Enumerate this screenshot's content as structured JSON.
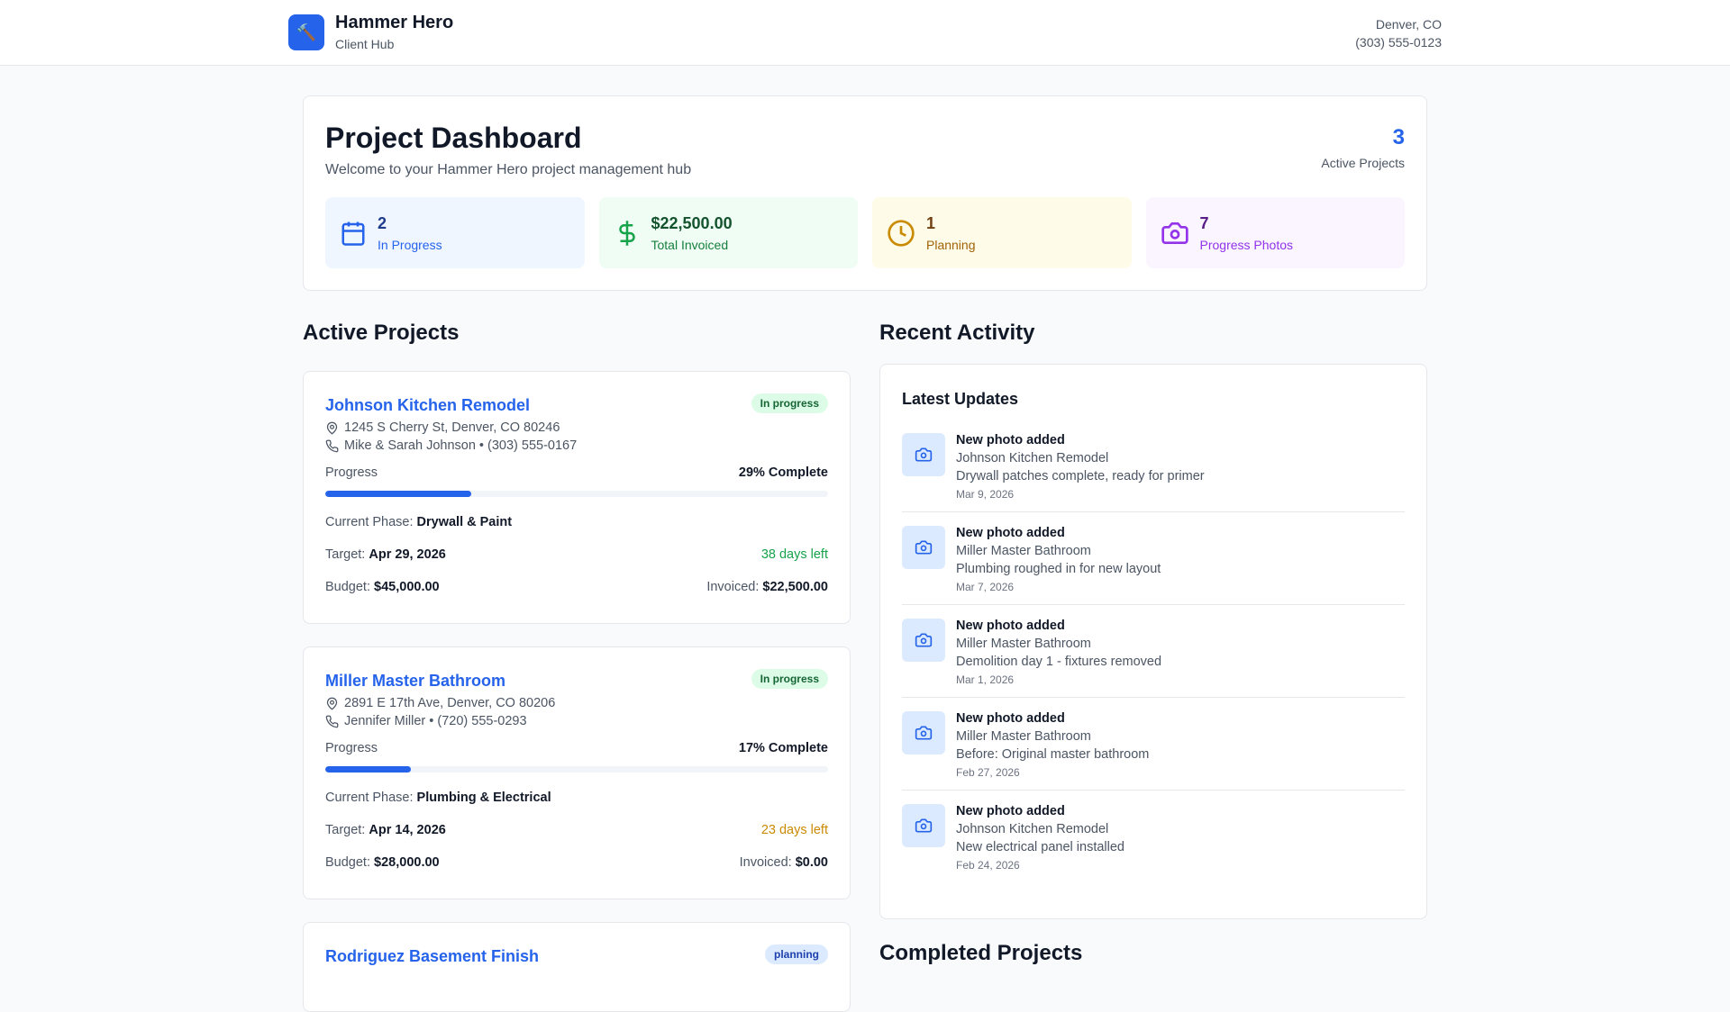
{
  "header": {
    "app_name": "Hammer Hero",
    "subtitle": "Client Hub",
    "location": "Denver, CO",
    "phone": "(303) 555-0123"
  },
  "dashboard": {
    "title": "Project Dashboard",
    "welcome": "Welcome to your Hammer Hero project management hub",
    "active_count": "3",
    "active_label": "Active Projects",
    "stats": [
      {
        "value": "2",
        "label": "In Progress",
        "icon": "calendar-icon",
        "color": "#2563eb"
      },
      {
        "value": "$22,500.00",
        "label": "Total Invoiced",
        "icon": "dollar-icon",
        "color": "#16a34a"
      },
      {
        "value": "1",
        "label": "Planning",
        "icon": "clock-icon",
        "color": "#ca8a04"
      },
      {
        "value": "7",
        "label": "Progress Photos",
        "icon": "camera-icon",
        "color": "#9333ea"
      }
    ]
  },
  "active_heading": "Active Projects",
  "projects": [
    {
      "name": "Johnson Kitchen Remodel",
      "status": "In progress",
      "address": "1245 S Cherry St, Denver, CO 80246",
      "contact": "Mike & Sarah Johnson • (303) 555-0167",
      "progress_label": "Progress",
      "progress_text": "29% Complete",
      "progress": 29,
      "phase_label": "Current Phase:",
      "phase": "Drywall & Paint",
      "target_label": "Target:",
      "target": "Apr 29, 2026",
      "days_left": "38 days left",
      "budget_label": "Budget:",
      "budget": "$45,000.00",
      "invoiced_label": "Invoiced:",
      "invoiced": "$22,500.00"
    },
    {
      "name": "Miller Master Bathroom",
      "status": "In progress",
      "address": "2891 E 17th Ave, Denver, CO 80206",
      "contact": "Jennifer Miller • (720) 555-0293",
      "progress_label": "Progress",
      "progress_text": "17% Complete",
      "progress": 17,
      "phase_label": "Current Phase:",
      "phase": "Plumbing & Electrical",
      "target_label": "Target:",
      "target": "Apr 14, 2026",
      "days_left": "23 days left",
      "budget_label": "Budget:",
      "budget": "$28,000.00",
      "invoiced_label": "Invoiced:",
      "invoiced": "$0.00"
    },
    {
      "name": "Rodriguez Basement Finish",
      "status": "planning"
    }
  ],
  "recent_heading": "Recent Activity",
  "activity": {
    "title": "Latest Updates",
    "items": [
      {
        "title": "New photo added",
        "project": "Johnson Kitchen Remodel",
        "desc": "Drywall patches complete, ready for primer",
        "date": "Mar 9, 2026"
      },
      {
        "title": "New photo added",
        "project": "Miller Master Bathroom",
        "desc": "Plumbing roughed in for new layout",
        "date": "Mar 7, 2026"
      },
      {
        "title": "New photo added",
        "project": "Miller Master Bathroom",
        "desc": "Demolition day 1 - fixtures removed",
        "date": "Mar 1, 2026"
      },
      {
        "title": "New photo added",
        "project": "Miller Master Bathroom",
        "desc": "Before: Original master bathroom",
        "date": "Feb 27, 2026"
      },
      {
        "title": "New photo added",
        "project": "Johnson Kitchen Remodel",
        "desc": "New electrical panel installed",
        "date": "Feb 24, 2026"
      }
    ]
  },
  "completed_heading": "Completed Projects"
}
